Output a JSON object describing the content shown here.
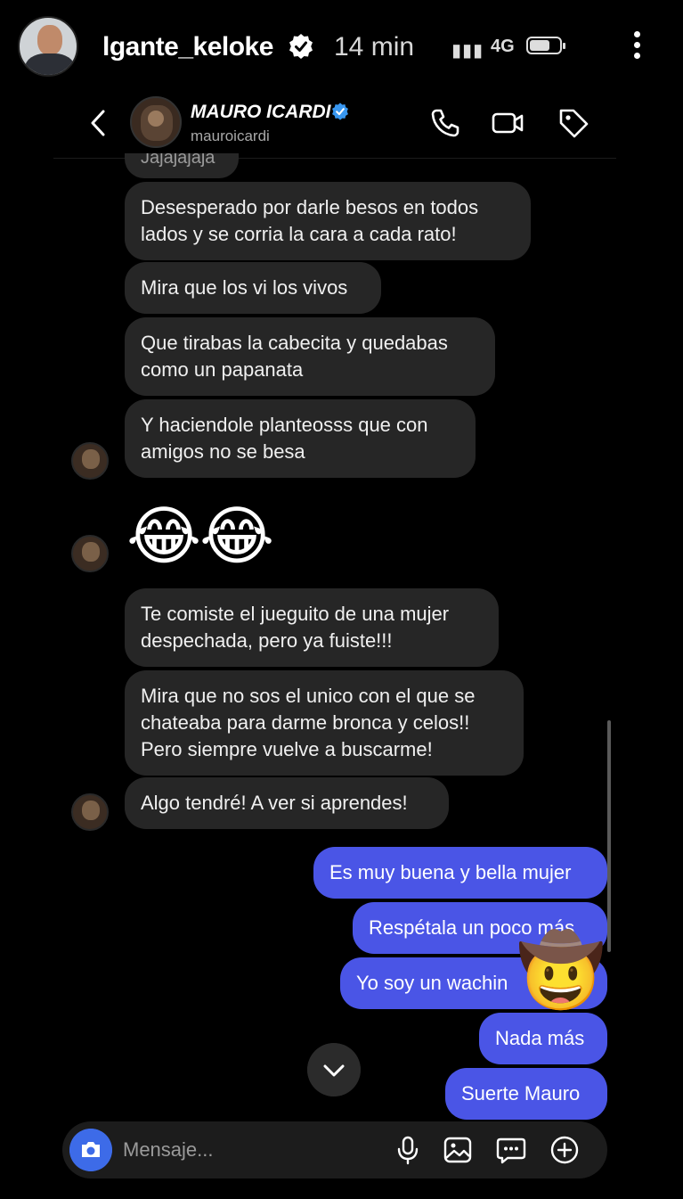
{
  "story": {
    "username": "lgante_keloke",
    "time_ago": "14 min",
    "network": "4G",
    "signal": "▮▮▮"
  },
  "dm": {
    "name": "MAURO ICARDI",
    "handle": "mauroicardi",
    "partial_text": "Jajajajaja",
    "emoji_row": [
      "😂",
      "😂"
    ],
    "incoming": [
      "Desesperado por darle besos en todos lados y se corria la cara a cada rato!",
      "Mira que los vi los vivos",
      "Que tirabas la cabecita y quedabas como un papanata",
      "Y haciendole planteosss que con amigos no se besa",
      "Te comiste el jueguito de una mujer despechada, pero ya fuiste!!!",
      "Mira que no sos el unico con el que se chateaba para darme bronca y celos!! Pero siempre vuelve a buscarme!",
      "Algo tendré! A ver si aprendes!"
    ],
    "outgoing": [
      "Es muy buena y bella mujer",
      "Respétala un poco más",
      "Yo soy un wachin",
      "Nada más",
      "Suerte Mauro"
    ],
    "sticker": "🤠",
    "composer_placeholder": "Mensaje..."
  },
  "colors": {
    "background": "#000000",
    "incoming_bubble": "#262626",
    "outgoing_bubble": "#4a55e6",
    "camera_button": "#3d6be8",
    "verified": "#3897f0"
  },
  "icons": [
    "more-vertical-icon",
    "verified-badge-icon",
    "back-arrow-icon",
    "phone-icon",
    "video-camera-icon",
    "tag-icon",
    "chevron-down-icon",
    "camera-icon",
    "microphone-icon",
    "gallery-icon",
    "sticker-icon",
    "plus-icon"
  ]
}
